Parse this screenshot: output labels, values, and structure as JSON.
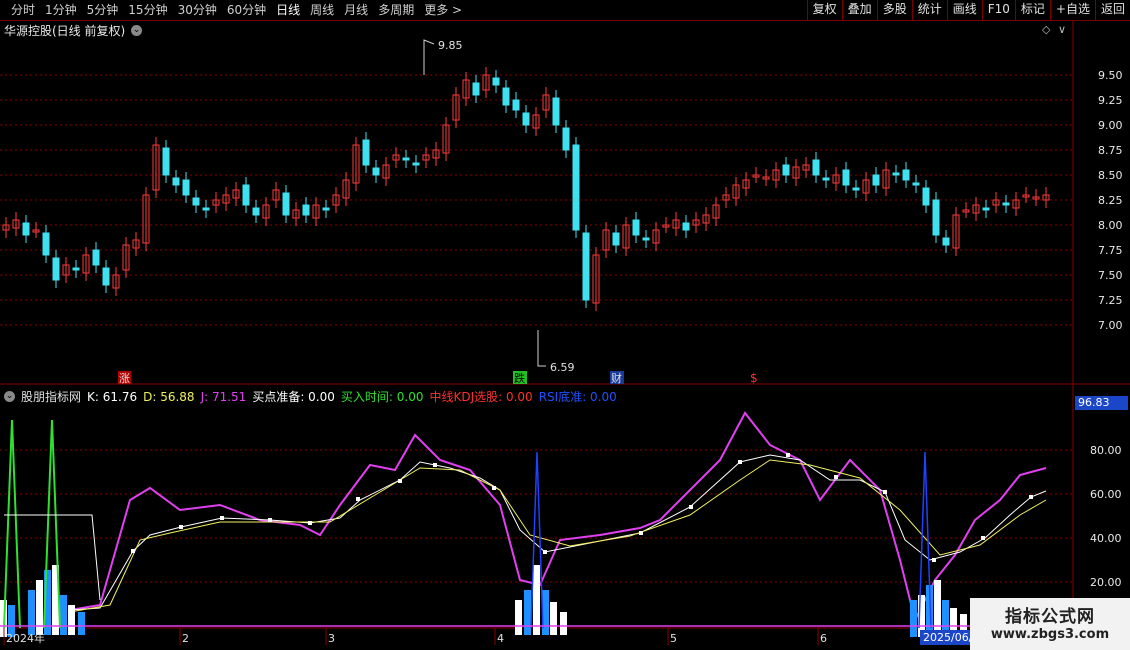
{
  "toolbar": {
    "periods": [
      "分时",
      "1分钟",
      "5分钟",
      "15分钟",
      "30分钟",
      "60分钟",
      "日线",
      "周线",
      "月线",
      "多周期",
      "更多 >"
    ],
    "active_period": "日线",
    "buttons": [
      "复权",
      "叠加",
      "多股",
      "统计",
      "画线",
      "F10",
      "标记",
      "+自选",
      "返回"
    ]
  },
  "stock": {
    "title": "华源控股(日线 前复权)"
  },
  "price_axis": [
    "9.50",
    "9.25",
    "9.00",
    "8.75",
    "8.50",
    "8.25",
    "8.00",
    "7.75",
    "7.50",
    "7.25",
    "7.00"
  ],
  "price_markers": {
    "high": "9.85",
    "low": "6.59"
  },
  "event_tags": [
    {
      "label": "涨",
      "color": "#e0e0e0",
      "bg": "#b00000"
    },
    {
      "label": "跌",
      "color": "#000",
      "bg": "#22c022"
    },
    {
      "label": "财",
      "color": "#e0e0e0",
      "bg": "#1a3a9a"
    },
    {
      "label": "$",
      "color": "#ff3030",
      "bg": "none"
    }
  ],
  "indicator": {
    "name": "股朋指标网",
    "k_label": "K: 61.76",
    "d_label": "D: 56.88",
    "j_label": "J: 71.51",
    "buy_prep": "买点准备: 0.00",
    "buy_time": "买入时间: 0.00",
    "mid_kdj": "中线KDJ选股: 0.00",
    "rsi": "RSI底准: 0.00",
    "current_value": "96.83",
    "axis": [
      "80.00",
      "60.00",
      "40.00",
      "20.00"
    ]
  },
  "date_axis": [
    "2024年",
    "2",
    "3",
    "4",
    "5",
    "6"
  ],
  "date_highlight": "2025/06/",
  "watermark": {
    "title": "指标公式网",
    "url": "www.zbgs3.com"
  },
  "colors": {
    "up": "#ff3b3b",
    "down": "#3fe0f0",
    "grid": "#8a0000",
    "k": "#ffffff",
    "d": "#f0f060",
    "j": "#e040f0"
  }
}
